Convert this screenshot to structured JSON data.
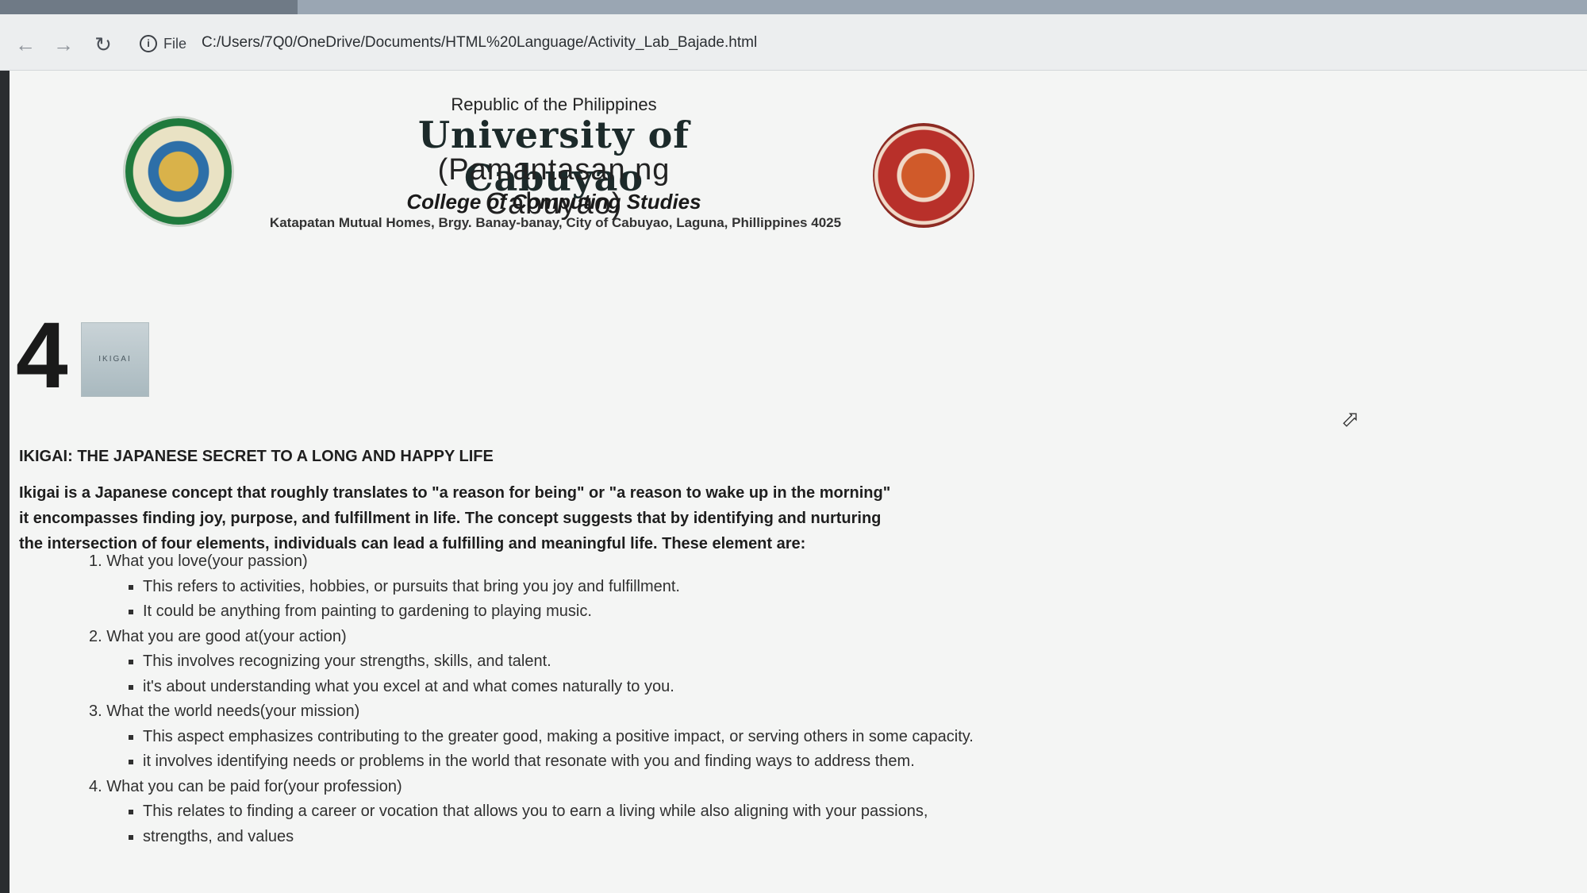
{
  "browser": {
    "site_info_label": "File",
    "url": "C:/Users/7Q0/OneDrive/Documents/HTML%20Language/Activity_Lab_Bajade.html"
  },
  "header": {
    "republic": "Republic of the Philippines",
    "university": "University of Cabuyao",
    "pamantasan": "(Pamantasan ng Cabuyao)",
    "college": "College of Computing Studies",
    "address": "Katapatan Mutual Homes, Brgy. Banay-banay, City of Cabuyao, Laguna, Phillippines 4025"
  },
  "content": {
    "number": "4",
    "thumbnail_label": "IKIGAI",
    "heading": "IKIGAI: THE JAPANESE SECRET TO A LONG AND HAPPY LIFE",
    "intro_lines": [
      "Ikigai is a Japanese concept that roughly translates to \"a reason for being\" or \"a reason to wake up in the morning\"",
      "it encompasses finding joy, purpose, and fulfillment in life. The concept suggests that by identifying and nurturing",
      "the intersection of four elements, individuals can lead a fulfilling and meaningful life. These element are:"
    ],
    "elements": [
      {
        "title": "1. What you love(your passion)",
        "points": [
          "This refers to activities, hobbies, or pursuits that bring you joy and fulfillment.",
          "It could be anything from painting to gardening to playing music."
        ]
      },
      {
        "title": "2. What you are good at(your action)",
        "points": [
          "This involves recognizing your strengths, skills, and talent.",
          "it's about understanding what you excel at and what comes naturally to you."
        ]
      },
      {
        "title": "3. What the world needs(your mission)",
        "points": [
          "This aspect emphasizes contributing to the greater good, making a positive impact, or serving others in some capacity.",
          "it involves identifying needs or problems in the world that resonate with you and finding ways to address them."
        ]
      },
      {
        "title": "4. What you can be paid for(your profession)",
        "points": [
          "This relates to finding a career or vocation that allows you to earn a living while also aligning with your passions,",
          "strengths, and values"
        ]
      }
    ]
  }
}
